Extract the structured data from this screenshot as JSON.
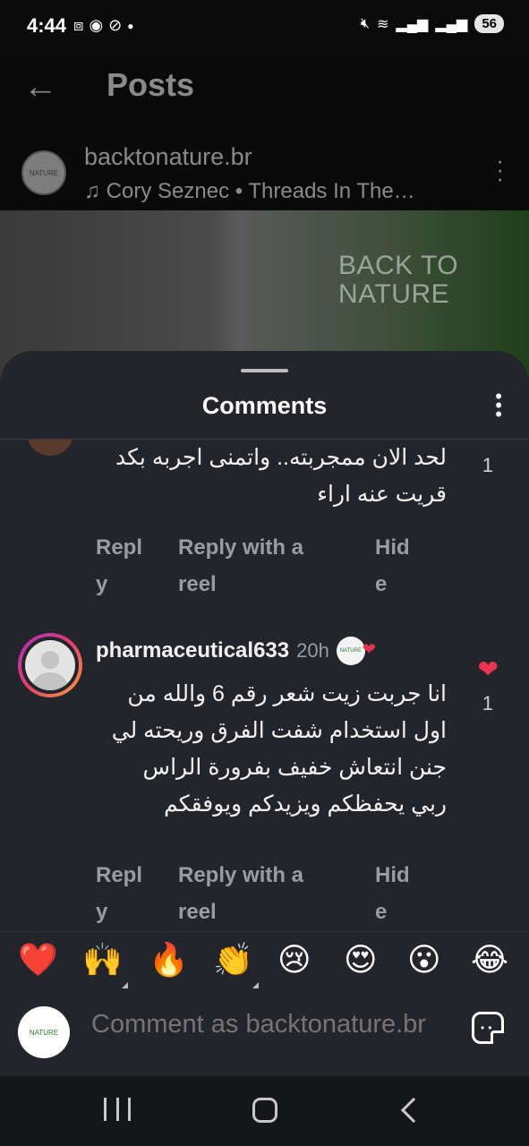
{
  "status_bar": {
    "time": "4:44",
    "battery": "56",
    "left_icons": [
      "screenshot-icon",
      "messenger-icon",
      "data-saver-icon",
      "dot-icon"
    ],
    "right_icons": [
      "mute-icon",
      "wifi-icon",
      "signal-icon",
      "signal-icon"
    ]
  },
  "header": {
    "title": "Posts"
  },
  "post": {
    "username": "backtonature.br",
    "audio": "Cory Seznec • Threads In The…",
    "image_text_line1": "BACK TO",
    "image_text_line2": "NATURE",
    "avatar_text": "NATURE"
  },
  "comments_sheet": {
    "title": "Comments",
    "comments": [
      {
        "text_line1": "لحد الان ممجربته.. واتمنى اجربه بكد",
        "text_line2": "قريت عنه اراء",
        "like_count": "1",
        "reply_label_1": "Repl",
        "reply_label_2": "y",
        "reply_reel_label_1": "Reply with a",
        "reply_reel_label_2": "reel",
        "hide_label_1": "Hid",
        "hide_label_2": "e"
      },
      {
        "username": "pharmaceutical633",
        "time": "20h",
        "text_line1": "انا جربت زيت شعر رقم 6 والله من",
        "text_line2": "اول استخدام شفت الفرق وريحته لي",
        "text_line3": "جنن انتعاش خفيف بفرورة الراس",
        "text_line4": "ربي يحفظكم ويزيدكم ويوفقكم",
        "like_count": "1",
        "reply_label_1": "Repl",
        "reply_label_2": "y",
        "reply_reel_label_1": "Reply with a",
        "reply_reel_label_2": "reel",
        "hide_label_1": "Hid",
        "hide_label_2": "e"
      }
    ]
  },
  "emoji_bar": [
    "❤️",
    "🙌",
    "🔥",
    "👏",
    "😢",
    "😍",
    "😮",
    "😂"
  ],
  "comment_input": {
    "placeholder": "Comment as backtonature.br"
  },
  "colors": {
    "sheet_bg": "#24252b",
    "like_red": "#e8344e",
    "muted_text": "#9b9ca3"
  }
}
